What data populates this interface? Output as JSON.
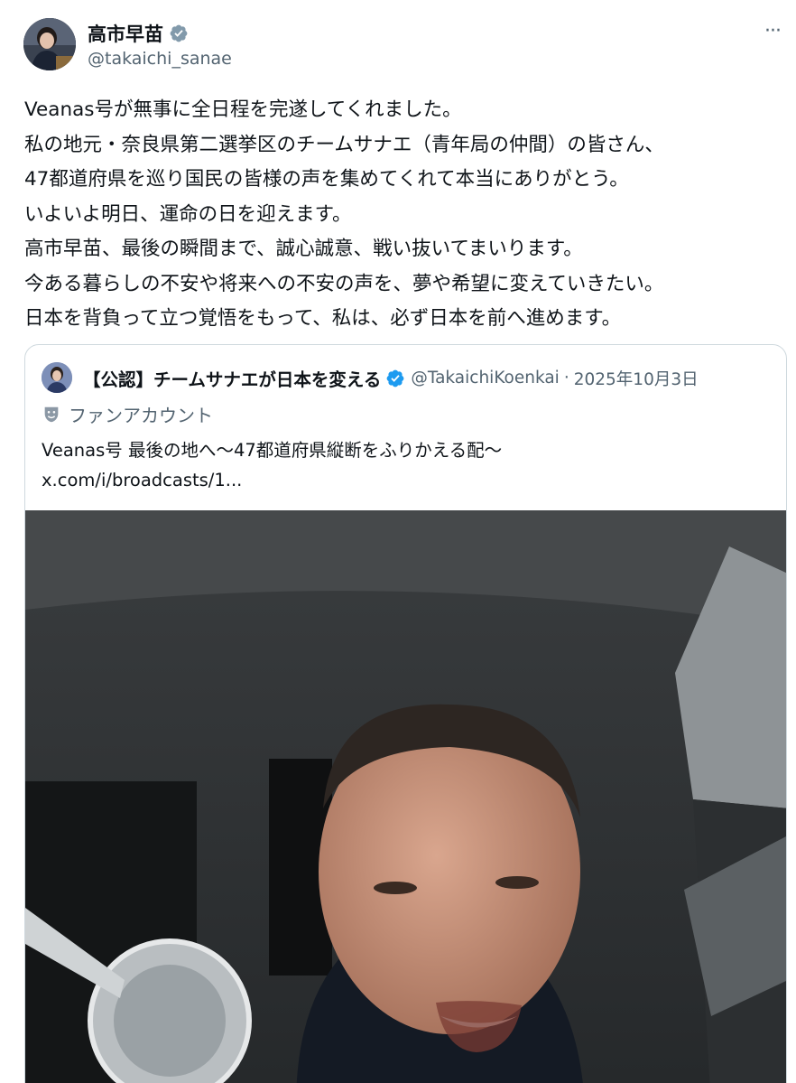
{
  "author": {
    "display_name": "高市早苗",
    "handle": "@takaichi_sanae",
    "avatar_icon": "profile-photo"
  },
  "more_label": "···",
  "body_lines": [
    "Veanas号が無事に全日程を完遂してくれました。",
    "私の地元・奈良県第二選挙区のチームサナエ（青年局の仲間）の皆さん、",
    "47都道府県を巡り国民の皆様の声を集めてくれて本当にありがとう。",
    "いよいよ明日、運命の日を迎えます。",
    "高市早苗、最後の瞬間まで、誠心誠意、戦い抜いてまいります。",
    "今ある暮らしの不安や将来への不安の声を、夢や希望に変えていきたい。",
    "日本を背負って立つ覚悟をもって、私は、必ず日本を前へ進めます。"
  ],
  "quote": {
    "display_name": "【公認】チームサナエが日本を変える",
    "handle": "@TakaichiKoenkai",
    "separator": "·",
    "date": "2025年10月3日",
    "fan_label": "ファンアカウント",
    "text_line1": "Veanas号 最後の地へ〜47都道府県縦断をふりかえる配〜",
    "text_line2": "x.com/i/broadcasts/1..."
  },
  "colors": {
    "text_primary": "#0f1419",
    "text_secondary": "#536471",
    "verified_blue": "#1d9bf0",
    "border": "#cfd9de"
  }
}
